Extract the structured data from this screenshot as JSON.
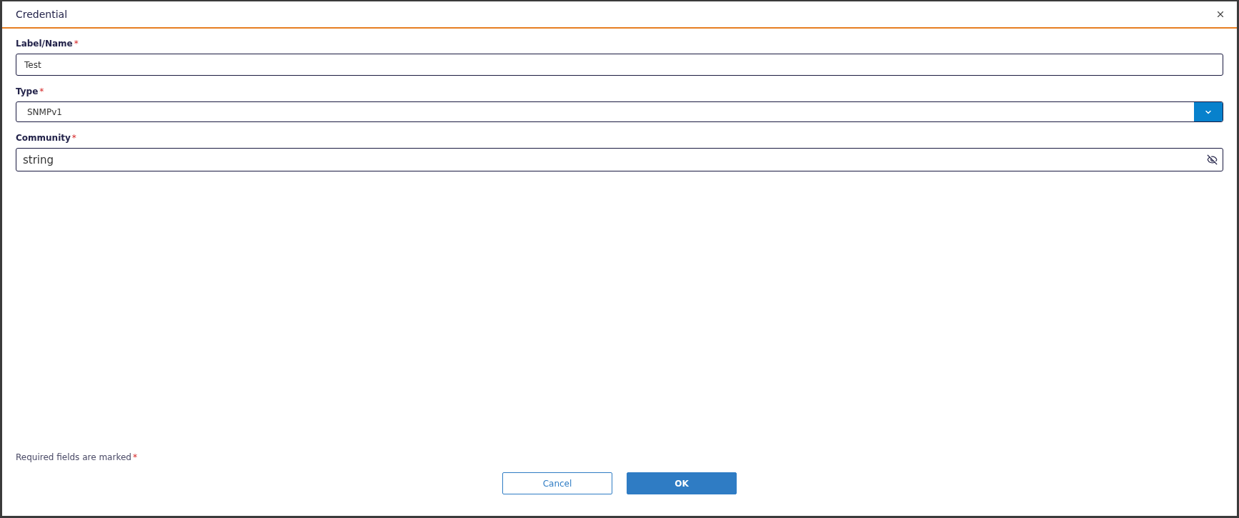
{
  "dialog": {
    "title": "Credential"
  },
  "fields": [
    {
      "kind": "text",
      "label": "Label/Name",
      "marker": "*",
      "value": "Test"
    },
    {
      "kind": "select",
      "label": "Type",
      "marker": "*",
      "value": "SNMPv1"
    },
    {
      "kind": "password",
      "label": "Community",
      "marker": "*",
      "value": "string",
      "revealed": true
    }
  ],
  "footer": {
    "note": "Required fields are marked",
    "marker": "*"
  },
  "buttons": [
    {
      "label": "Cancel",
      "kind": "secondary"
    },
    {
      "label": "OK",
      "kind": "primary"
    }
  ]
}
